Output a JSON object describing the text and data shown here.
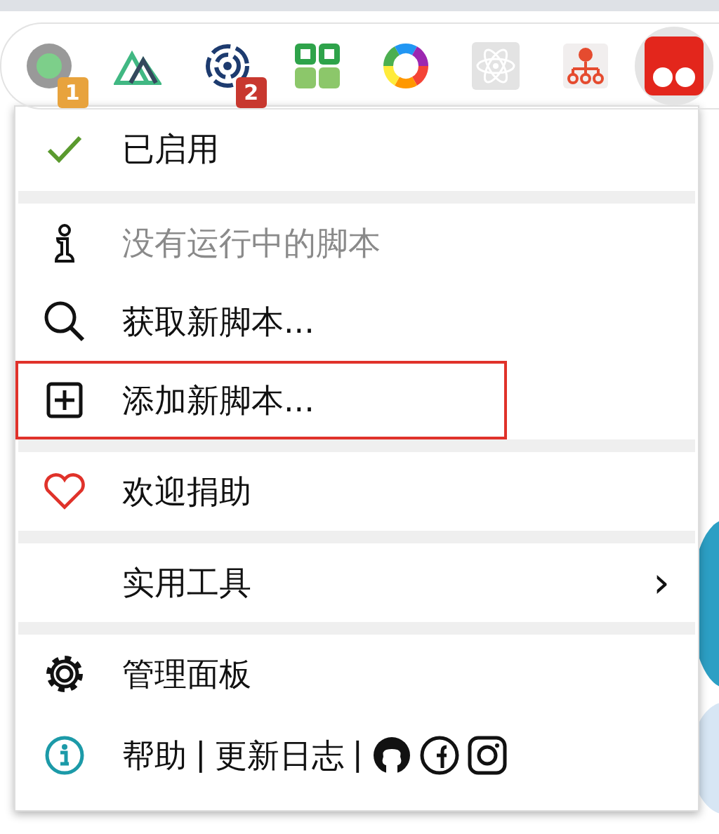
{
  "toolbar": {
    "extensions": [
      {
        "badge": "1",
        "color": "#e8a33d",
        "active": false
      },
      {
        "active": false
      },
      {
        "badge": "2",
        "color": "#c8382f",
        "active": false
      },
      {
        "active": false
      },
      {
        "active": false
      },
      {
        "active": false
      },
      {
        "active": false
      },
      {
        "active": true
      }
    ]
  },
  "menu": {
    "items": [
      {
        "kind": "item",
        "label": "已启用",
        "disabled": false,
        "highlighted": false
      },
      {
        "kind": "separator"
      },
      {
        "kind": "item",
        "label": "没有运行中的脚本",
        "disabled": true,
        "highlighted": false
      },
      {
        "kind": "item",
        "label": "获取新脚本...",
        "disabled": false,
        "highlighted": false
      },
      {
        "kind": "item",
        "label": "添加新脚本...",
        "disabled": false,
        "highlighted": true
      },
      {
        "kind": "separator"
      },
      {
        "kind": "item",
        "label": "欢迎捐助",
        "disabled": false,
        "highlighted": false
      },
      {
        "kind": "separator"
      },
      {
        "kind": "submenu",
        "label": "实用工具",
        "arrow": "›"
      },
      {
        "kind": "separator"
      },
      {
        "kind": "item",
        "label": "管理面板",
        "disabled": false,
        "highlighted": false
      },
      {
        "kind": "footer",
        "links": [
          "帮助",
          "更新日志"
        ],
        "divider": "|"
      }
    ]
  }
}
